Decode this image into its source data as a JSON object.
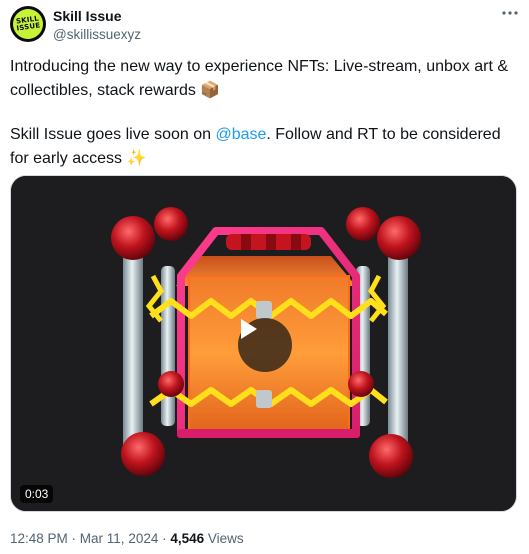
{
  "author": {
    "avatar_line1": "SKILL",
    "avatar_line2": "ISSUE",
    "name": "Skill Issue",
    "handle": "@skillissuexyz"
  },
  "tweet": {
    "line1_text": "Introducing the new way to experience NFTs: Live-stream, unbox art & collectibles, stack rewards ",
    "line1_emoji": "📦",
    "line2_before": "Skill Issue goes live soon on ",
    "line2_mention": "@base",
    "line2_after": ". Follow and RT to be considered for early access ",
    "line2_emoji": "✨"
  },
  "media": {
    "duration": "0:03",
    "progress": 0
  },
  "meta": {
    "time": "12:48 PM",
    "separator": " · ",
    "date": "Mar 11, 2024",
    "views_count": "4,546",
    "views_label": " Views"
  },
  "colors": {
    "link": "#1d9bf0",
    "secondary_text": "#536471",
    "avatar_accent": "#c6f23a"
  }
}
